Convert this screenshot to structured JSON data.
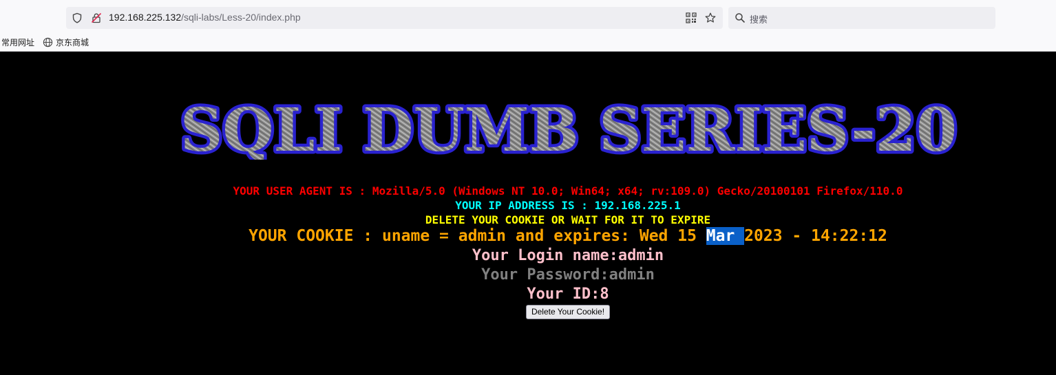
{
  "browser": {
    "url_host": "192.168.225.132",
    "url_path": "/sqli-labs/Less-20/index.php",
    "search_placeholder": "搜索",
    "bookmarks": [
      {
        "label": "常用网址"
      },
      {
        "label": "京东商城"
      }
    ]
  },
  "page": {
    "banner_text": "SQLI DUMB SERIES-20",
    "user_agent_line": "YOUR USER AGENT IS : Mozilla/5.0 (Windows NT 10.0; Win64; x64; rv:109.0) Gecko/20100101 Firefox/110.0",
    "ip_line": "YOUR IP ADDRESS IS : 192.168.225.1",
    "delete_notice": "DELETE YOUR COOKIE OR WAIT FOR IT TO EXPIRE",
    "cookie_line": {
      "before": "YOUR COOKIE : uname = admin and expires: Wed 15 ",
      "selected": "Mar ",
      "after": "2023 - 14:22:12"
    },
    "login_name": "Your Login name:admin",
    "password": "Your Password:admin",
    "user_id": "Your ID:8",
    "delete_button": "Delete Your Cookie!"
  },
  "colors": {
    "page_bg": "#000000",
    "user_agent": "#ff0000",
    "ip": "#00ffff",
    "notice": "#ffff00",
    "cookie": "#ffa500",
    "login": "#ffc0cb",
    "password": "#808080",
    "selection": "#0a60c8"
  }
}
